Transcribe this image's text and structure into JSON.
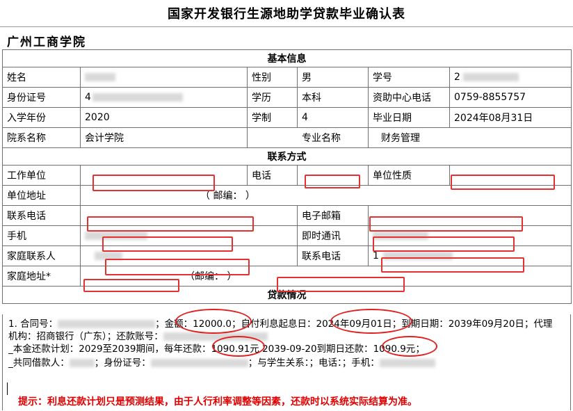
{
  "header": {
    "title": "国家开发银行生源地助学贷款毕业确认表",
    "school": "广州工商学院"
  },
  "basic": {
    "section": "基本信息",
    "rows": [
      [
        {
          "t": "姓名"
        },
        {
          "t": ""
        },
        {
          "t": "性别"
        },
        {
          "t": "男"
        },
        {
          "t": "学号"
        },
        {
          "t": "2"
        }
      ],
      [
        {
          "t": "身份证号"
        },
        {
          "t": "4"
        },
        {
          "t": "学历"
        },
        {
          "t": "本科"
        },
        {
          "t": "资助中心电话"
        },
        {
          "t": "0759-8855757"
        }
      ],
      [
        {
          "t": "入学年份"
        },
        {
          "t": "2020"
        },
        {
          "t": "学制"
        },
        {
          "t": "4"
        },
        {
          "t": "毕业日期"
        },
        {
          "t": "2024年08月31日"
        }
      ],
      [
        {
          "t": "院系名称"
        },
        {
          "t": "会计学院"
        },
        {
          "t": "专业名称"
        },
        {
          "t": "财务管理"
        }
      ]
    ]
  },
  "contact": {
    "section": "联系方式",
    "work_unit": "工作单位",
    "phone": "电话",
    "unit_type": "单位性质",
    "unit_address": "单位地址",
    "postcode_paren": "（  邮编：    ）",
    "contact_phone": "联系电话",
    "email": "电子邮箱",
    "mobile": "手机",
    "im": "即时通讯",
    "im_prefix": "",
    "family_contact": "家庭联系人",
    "family_contact_prefix": "",
    "family_phone": "联系电话",
    "family_phone_prefix": "1",
    "home_address": "家庭地址*",
    "home_postcode": "（邮编：    ）"
  },
  "loan": {
    "section": "贷款情况",
    "line1_a": "1. 合同号：",
    "line1_b": "；",
    "amount": "金额：12000.0",
    "line1_c": "；自付利息起息日：",
    "interest_date": "2024年09月01日",
    "line1_d": "；到期日期：2039年09月20日；代理",
    "line2": "机构：招商银行（广东）；还款账号：",
    "line3_a": "_本金还款计划：2029至2039期间，每年还款：",
    "yearly": "1090.91元",
    "line3_b": "2039-09-20到期日还款：",
    "final": "1090.9元",
    "line3_c": "；",
    "line4_a": "_共同借款人：",
    "line4_b": "；身份证号：",
    "line4_c": "；与学生关系：；电话：；手机：",
    "hint": "提示：利息还款计划只是预测结果，由于人行利率调整等因素，还款时以系统实际结算为准。"
  }
}
